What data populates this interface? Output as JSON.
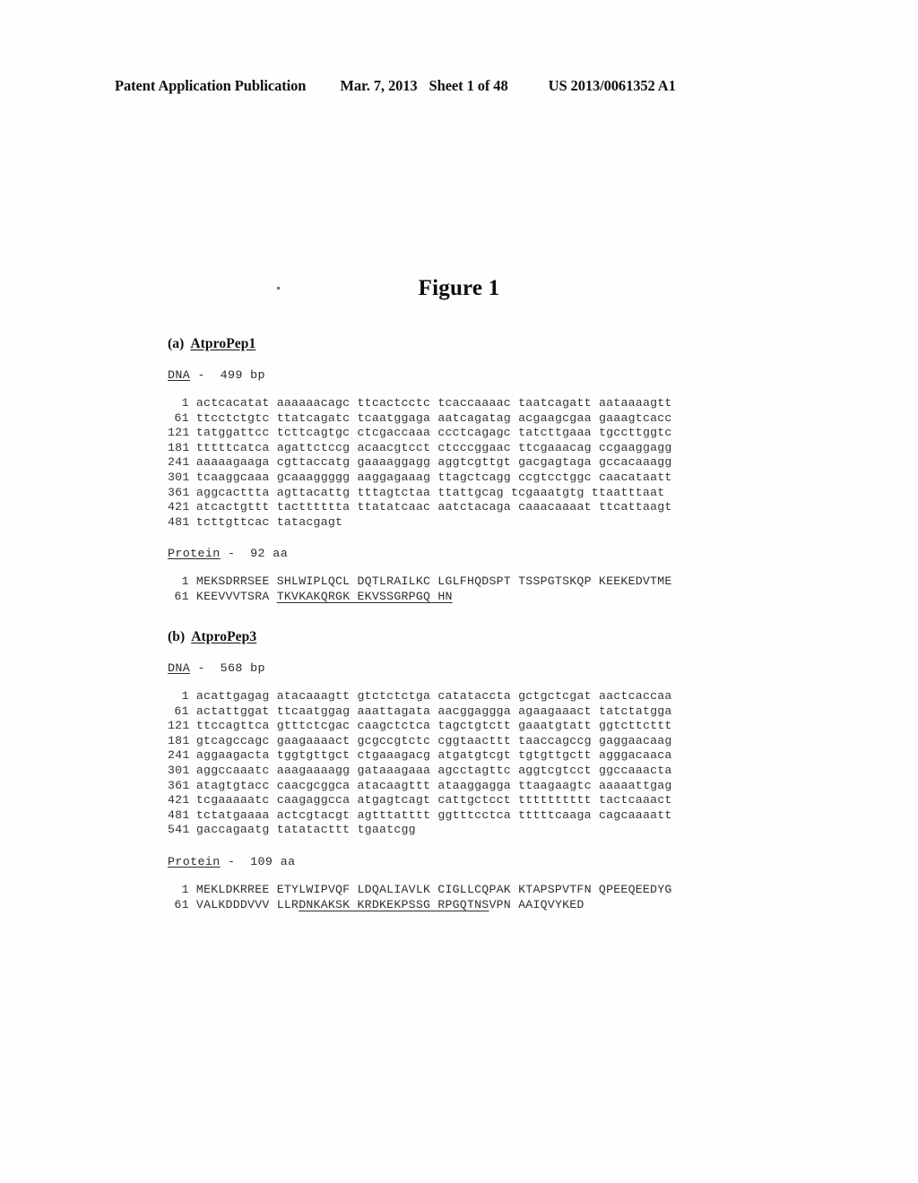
{
  "header": {
    "publication": "Patent Application Publication",
    "date": "Mar. 7, 2013",
    "sheet": "Sheet 1 of 48",
    "number": "US 2013/0061352 A1"
  },
  "figure": {
    "title": "Figure 1"
  },
  "sections": [
    {
      "label": "(a)",
      "name": "AtproPep1",
      "dna": {
        "heading_label": "DNA",
        "heading_rest": " -  499 bp",
        "rows": [
          {
            "index": "1",
            "groups": [
              "actcacatat",
              "aaaaaacagc",
              "ttcactcctc",
              "tcaccaaaac",
              "taatcagatt",
              "aataaaagtt"
            ]
          },
          {
            "index": "61",
            "groups": [
              "ttcctctgtc",
              "ttatcagatc",
              "tcaatggaga",
              "aatcagatag",
              "acgaagcgaa",
              "gaaagtcacc"
            ]
          },
          {
            "index": "121",
            "groups": [
              "tatggattcc",
              "tcttcagtgc",
              "ctcgaccaaa",
              "ccctcagagc",
              "tatcttgaaa",
              "tgccttggtc"
            ]
          },
          {
            "index": "181",
            "groups": [
              "tttttcatca",
              "agattctccg",
              "acaacgtcct",
              "ctcccggaac",
              "ttcgaaacag",
              "ccgaaggagg"
            ]
          },
          {
            "index": "241",
            "groups": [
              "aaaaagaaga",
              "cgttaccatg",
              "gaaaaggagg",
              "aggtcgttgt",
              "gacgagtaga",
              "gccacaaagg"
            ]
          },
          {
            "index": "301",
            "groups": [
              "tcaaggcaaa",
              "gcaaaggggg",
              "aaggagaaag",
              "ttagctcagg",
              "ccgtcctggc",
              "caacataatt"
            ]
          },
          {
            "index": "361",
            "groups": [
              "aggcacttta",
              "agttacattg",
              "tttagtctaa",
              "ttattgcag",
              "tcgaaatgtg",
              "ttaatttaat"
            ]
          },
          {
            "index": "421",
            "groups": [
              "atcactgttt",
              "tactttttta",
              "ttatatcaac",
              "aatctacaga",
              "caaacaaaat",
              "ttcattaagt"
            ]
          },
          {
            "index": "481",
            "groups": [
              "tcttgttcac",
              "tatacgagt"
            ]
          }
        ]
      },
      "protein": {
        "heading_label": "Protein",
        "heading_rest": " -  92 aa",
        "rows": [
          {
            "index": "1",
            "plain_pre": "MEKSDRRSEE SHLWIPLQCL DQTLRAILKC LGLFHQDSPT TSSPGTSKQP KEEKEDVTME",
            "underlined": "",
            "plain_post": ""
          },
          {
            "index": "61",
            "plain_pre": "KEEVVVTSRA ",
            "underlined": "TKVKAKQRGK EKVSSGRPGQ HN",
            "plain_post": ""
          }
        ]
      }
    },
    {
      "label": "(b)",
      "name": "AtproPep3",
      "dna": {
        "heading_label": "DNA",
        "heading_rest": " -  568 bp",
        "rows": [
          {
            "index": "1",
            "groups": [
              "acattgagag",
              "atacaaagtt",
              "gtctctctga",
              "catataccta",
              "gctgctcgat",
              "aactcaccaa"
            ]
          },
          {
            "index": "61",
            "groups": [
              "actattggat",
              "ttcaatggag",
              "aaattagata",
              "aacggaggga",
              "agaagaaact",
              "tatctatgga"
            ]
          },
          {
            "index": "121",
            "groups": [
              "ttccagttca",
              "gtttctcgac",
              "caagctctca",
              "tagctgtctt",
              "gaaatgtatt",
              "ggtcttcttt"
            ]
          },
          {
            "index": "181",
            "groups": [
              "gtcagccagc",
              "gaagaaaact",
              "gcgccgtctc",
              "cggtaacttt",
              "taaccagccg",
              "gaggaacaag"
            ]
          },
          {
            "index": "241",
            "groups": [
              "aggaagacta",
              "tggtgttgct",
              "ctgaaagacg",
              "atgatgtcgt",
              "tgtgttgctt",
              "agggacaaca"
            ]
          },
          {
            "index": "301",
            "groups": [
              "aggccaaatc",
              "aaagaaaagg",
              "gataaagaaa",
              "agcctagttc",
              "aggtcgtcct",
              "ggccaaacta"
            ]
          },
          {
            "index": "361",
            "groups": [
              "atagtgtacc",
              "caacgcggca",
              "atacaagttt",
              "ataaggagga",
              "ttaagaagtc",
              "aaaaattgag"
            ]
          },
          {
            "index": "421",
            "groups": [
              "tcgaaaaatc",
              "caagaggcca",
              "atgagtcagt",
              "cattgctcct",
              "tttttttttt",
              "tactcaaact"
            ]
          },
          {
            "index": "481",
            "groups": [
              "tctatgaaaa",
              "actcgtacgt",
              "agtttatttt",
              "ggtttcctca",
              "tttttcaaga",
              "cagcaaaatt"
            ]
          },
          {
            "index": "541",
            "groups": [
              "gaccagaatg",
              "tatatacttt",
              "tgaatcgg"
            ]
          }
        ]
      },
      "protein": {
        "heading_label": "Protein",
        "heading_rest": " -  109 aa",
        "rows": [
          {
            "index": "1",
            "plain_pre": "MEKLDKRREE ETYLWIPVQF LDQALIAVLK CIGLLCQPAK KTAPSPVTFN QPEEQEEDYG",
            "underlined": "",
            "plain_post": ""
          },
          {
            "index": "61",
            "plain_pre": "VALKDDDVVV LLR",
            "underlined": "DNKAKSK KRDKEKPSSG RPGQTNS",
            "plain_post": "VPN AAIQVYKED"
          }
        ]
      }
    }
  ]
}
